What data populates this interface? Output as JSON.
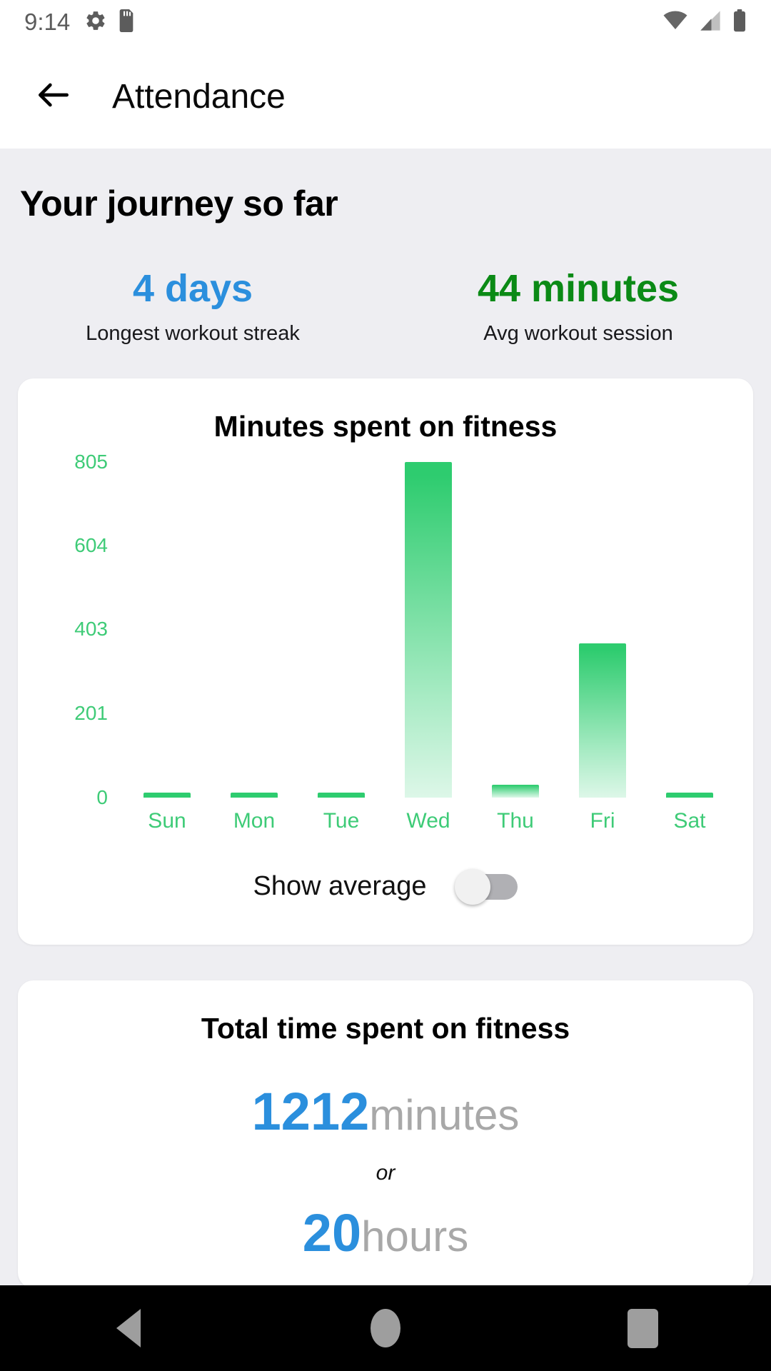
{
  "status_bar": {
    "time": "9:14",
    "left_icons": [
      "gear-icon",
      "sd-card-icon"
    ],
    "right_icons": [
      "wifi-icon",
      "cellular-signal-icon",
      "battery-icon"
    ]
  },
  "app_bar": {
    "back_icon": "arrow-left-icon",
    "title": "Attendance"
  },
  "page": {
    "heading": "Your journey so far"
  },
  "stats": [
    {
      "value": "4 days",
      "label": "Longest workout streak",
      "color": "#2b8fdd"
    },
    {
      "value": "44 minutes",
      "label": "Avg workout session",
      "color": "#0b8a16"
    }
  ],
  "chart_card": {
    "title": "Minutes spent on fitness",
    "toggle_label": "Show average",
    "toggle_state": "off"
  },
  "total_card": {
    "title": "Total time spent on fitness",
    "value": "1212",
    "unit": "minutes",
    "or": "or",
    "value2": "20",
    "unit2": "hours"
  },
  "nav_bar": {
    "back": "nav-back-triangle-icon",
    "home": "nav-home-circle-icon",
    "recents": "nav-recents-square-icon"
  },
  "chart_data": {
    "type": "bar",
    "title": "Minutes spent on fitness",
    "xlabel": "",
    "ylabel": "",
    "categories": [
      "Sun",
      "Mon",
      "Tue",
      "Wed",
      "Thu",
      "Fri",
      "Sat"
    ],
    "values": [
      4,
      2,
      6,
      805,
      30,
      370,
      3
    ],
    "ytick_labels": [
      "0",
      "201",
      "403",
      "604",
      "805"
    ],
    "yticks": [
      0,
      201,
      403,
      604,
      805
    ],
    "ylim": [
      0,
      805
    ],
    "grid": false,
    "legend": false,
    "bar_color_top": "#2ecc6f",
    "bar_color_bottom": "#ddf7e8",
    "axis_label_color": "#3ecb77"
  }
}
